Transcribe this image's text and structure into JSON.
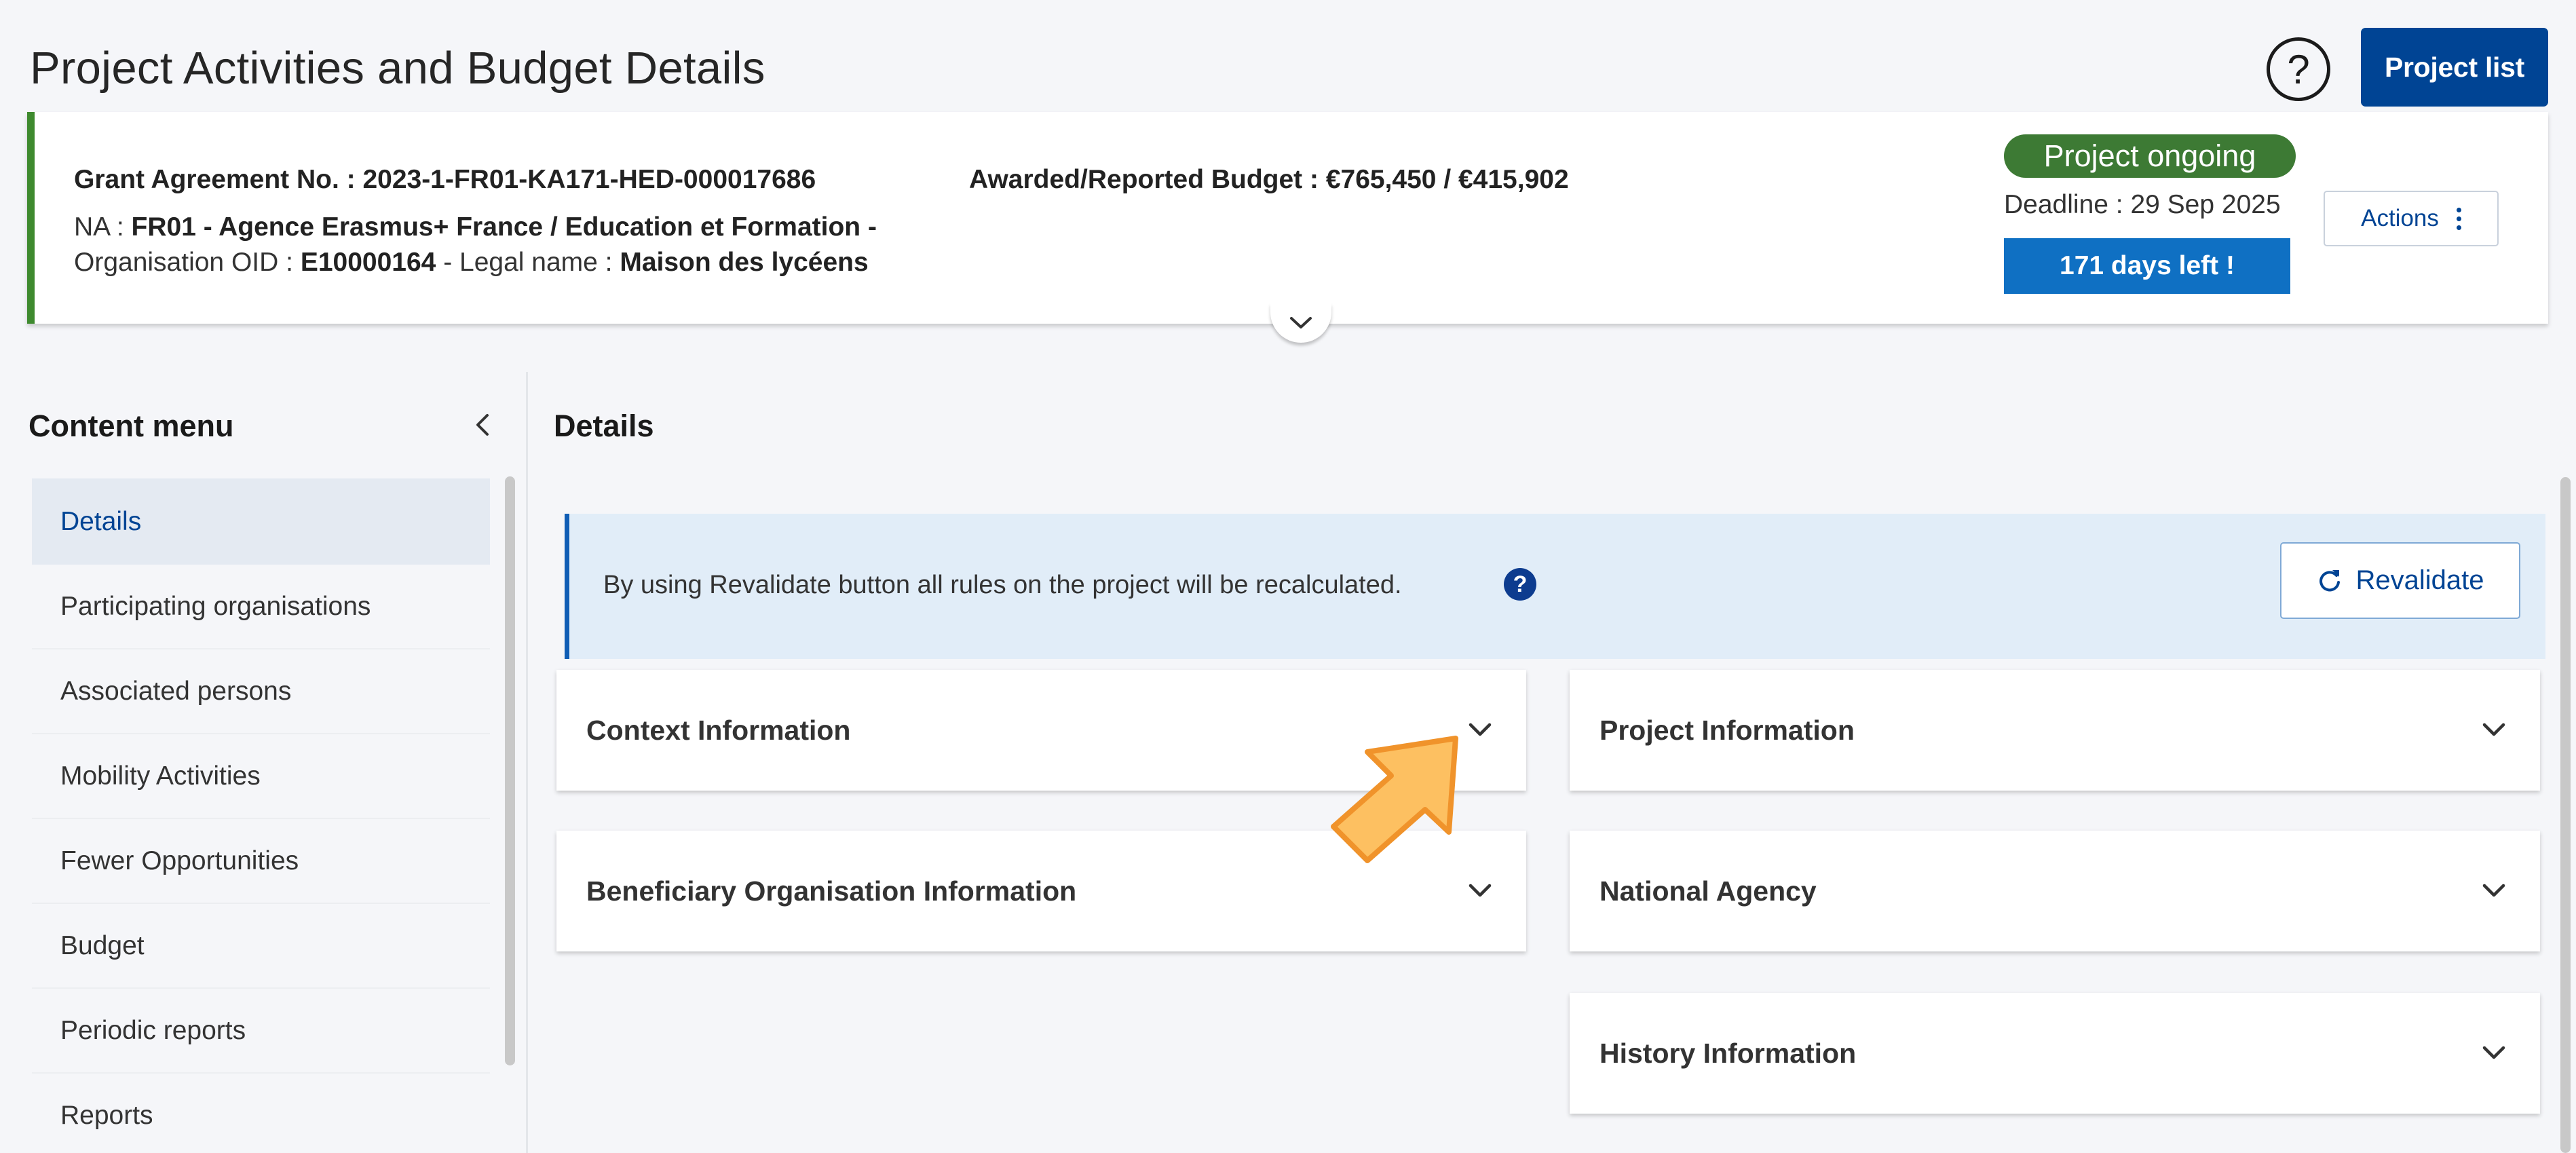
{
  "header": {
    "title": "Project Activities and Budget Details",
    "help_icon": "question-circle-icon",
    "project_list_label": "Project list"
  },
  "project": {
    "grant_agreement": "Grant Agreement No. : 2023-1-FR01-KA171-HED-000017686",
    "budget": "Awarded/Reported Budget : €765,450 / €415,902",
    "na_prefix": "NA : ",
    "na_value": "FR01 - Agence Erasmus+ France / Education et Formation -",
    "org_oid_label": "Organisation OID : ",
    "org_oid_value": "E10000164",
    "legal_name_label": " - Legal name : ",
    "legal_name_value": "Maison des lycéens",
    "status": "Project ongoing",
    "deadline": "Deadline : 29 Sep 2025",
    "days_left": "171 days left !",
    "actions_label": "Actions",
    "status_color": "#3d7a34",
    "accent_color": "#004494"
  },
  "content_menu": {
    "title": "Content menu",
    "items": [
      {
        "label": "Details",
        "active": true
      },
      {
        "label": "Participating organisations"
      },
      {
        "label": "Associated persons"
      },
      {
        "label": "Mobility Activities"
      },
      {
        "label": "Fewer Opportunities"
      },
      {
        "label": "Budget"
      },
      {
        "label": "Periodic reports"
      },
      {
        "label": "Reports"
      }
    ]
  },
  "main": {
    "section_title": "Details",
    "banner_text": "By using Revalidate button all rules on the project will be recalculated.",
    "banner_help": "?",
    "revalidate_label": "Revalidate",
    "panels": {
      "context": "Context Information",
      "project": "Project Information",
      "beneficiary": "Beneficiary Organisation Information",
      "national": "National Agency",
      "history": "History Information"
    }
  }
}
